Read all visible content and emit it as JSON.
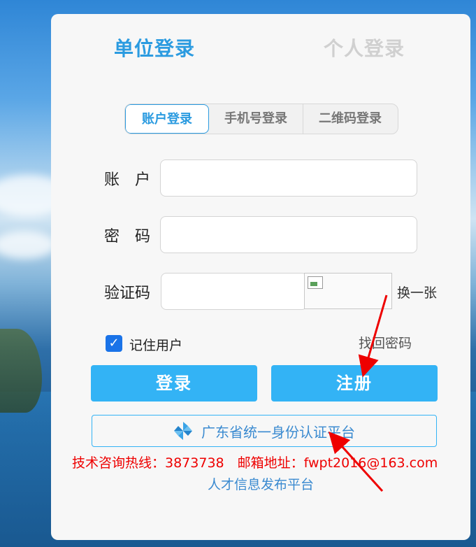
{
  "top_tabs": {
    "unit": "单位登录",
    "personal": "个人登录"
  },
  "segments": [
    "账户登录",
    "手机号登录",
    "二维码登录"
  ],
  "form": {
    "account_label": "账　户",
    "password_label": "密　码",
    "captcha_label": "验证码",
    "refresh_label": "换一张",
    "remember_label": "记住用户",
    "forgot_label": "找回密码"
  },
  "buttons": {
    "login": "登录",
    "register": "注册"
  },
  "unified_auth": "广东省统一身份认证平台",
  "footer": {
    "hotline": "技术咨询热线：3873738　邮箱地址：fwpt2016@163.com",
    "talent": "人才信息发布平台"
  },
  "colors": {
    "accent": "#2b9be0",
    "button": "#33b3f5",
    "warning": "#ee0000"
  },
  "icons": {
    "checkbox": "checkmark-icon",
    "unified": "pinwheel-icon"
  }
}
